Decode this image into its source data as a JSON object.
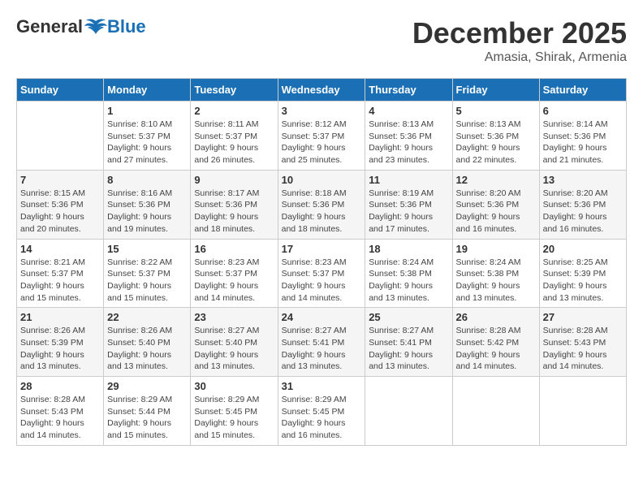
{
  "logo": {
    "general": "General",
    "blue": "Blue"
  },
  "title": {
    "month": "December 2025",
    "location": "Amasia, Shirak, Armenia"
  },
  "days_of_week": [
    "Sunday",
    "Monday",
    "Tuesday",
    "Wednesday",
    "Thursday",
    "Friday",
    "Saturday"
  ],
  "weeks": [
    [
      {
        "day": "",
        "info": ""
      },
      {
        "day": "1",
        "info": "Sunrise: 8:10 AM\nSunset: 5:37 PM\nDaylight: 9 hours\nand 27 minutes."
      },
      {
        "day": "2",
        "info": "Sunrise: 8:11 AM\nSunset: 5:37 PM\nDaylight: 9 hours\nand 26 minutes."
      },
      {
        "day": "3",
        "info": "Sunrise: 8:12 AM\nSunset: 5:37 PM\nDaylight: 9 hours\nand 25 minutes."
      },
      {
        "day": "4",
        "info": "Sunrise: 8:13 AM\nSunset: 5:36 PM\nDaylight: 9 hours\nand 23 minutes."
      },
      {
        "day": "5",
        "info": "Sunrise: 8:13 AM\nSunset: 5:36 PM\nDaylight: 9 hours\nand 22 minutes."
      },
      {
        "day": "6",
        "info": "Sunrise: 8:14 AM\nSunset: 5:36 PM\nDaylight: 9 hours\nand 21 minutes."
      }
    ],
    [
      {
        "day": "7",
        "info": "Sunrise: 8:15 AM\nSunset: 5:36 PM\nDaylight: 9 hours\nand 20 minutes."
      },
      {
        "day": "8",
        "info": "Sunrise: 8:16 AM\nSunset: 5:36 PM\nDaylight: 9 hours\nand 19 minutes."
      },
      {
        "day": "9",
        "info": "Sunrise: 8:17 AM\nSunset: 5:36 PM\nDaylight: 9 hours\nand 18 minutes."
      },
      {
        "day": "10",
        "info": "Sunrise: 8:18 AM\nSunset: 5:36 PM\nDaylight: 9 hours\nand 18 minutes."
      },
      {
        "day": "11",
        "info": "Sunrise: 8:19 AM\nSunset: 5:36 PM\nDaylight: 9 hours\nand 17 minutes."
      },
      {
        "day": "12",
        "info": "Sunrise: 8:20 AM\nSunset: 5:36 PM\nDaylight: 9 hours\nand 16 minutes."
      },
      {
        "day": "13",
        "info": "Sunrise: 8:20 AM\nSunset: 5:36 PM\nDaylight: 9 hours\nand 16 minutes."
      }
    ],
    [
      {
        "day": "14",
        "info": "Sunrise: 8:21 AM\nSunset: 5:37 PM\nDaylight: 9 hours\nand 15 minutes."
      },
      {
        "day": "15",
        "info": "Sunrise: 8:22 AM\nSunset: 5:37 PM\nDaylight: 9 hours\nand 15 minutes."
      },
      {
        "day": "16",
        "info": "Sunrise: 8:23 AM\nSunset: 5:37 PM\nDaylight: 9 hours\nand 14 minutes."
      },
      {
        "day": "17",
        "info": "Sunrise: 8:23 AM\nSunset: 5:37 PM\nDaylight: 9 hours\nand 14 minutes."
      },
      {
        "day": "18",
        "info": "Sunrise: 8:24 AM\nSunset: 5:38 PM\nDaylight: 9 hours\nand 13 minutes."
      },
      {
        "day": "19",
        "info": "Sunrise: 8:24 AM\nSunset: 5:38 PM\nDaylight: 9 hours\nand 13 minutes."
      },
      {
        "day": "20",
        "info": "Sunrise: 8:25 AM\nSunset: 5:39 PM\nDaylight: 9 hours\nand 13 minutes."
      }
    ],
    [
      {
        "day": "21",
        "info": "Sunrise: 8:26 AM\nSunset: 5:39 PM\nDaylight: 9 hours\nand 13 minutes."
      },
      {
        "day": "22",
        "info": "Sunrise: 8:26 AM\nSunset: 5:40 PM\nDaylight: 9 hours\nand 13 minutes."
      },
      {
        "day": "23",
        "info": "Sunrise: 8:27 AM\nSunset: 5:40 PM\nDaylight: 9 hours\nand 13 minutes."
      },
      {
        "day": "24",
        "info": "Sunrise: 8:27 AM\nSunset: 5:41 PM\nDaylight: 9 hours\nand 13 minutes."
      },
      {
        "day": "25",
        "info": "Sunrise: 8:27 AM\nSunset: 5:41 PM\nDaylight: 9 hours\nand 13 minutes."
      },
      {
        "day": "26",
        "info": "Sunrise: 8:28 AM\nSunset: 5:42 PM\nDaylight: 9 hours\nand 14 minutes."
      },
      {
        "day": "27",
        "info": "Sunrise: 8:28 AM\nSunset: 5:43 PM\nDaylight: 9 hours\nand 14 minutes."
      }
    ],
    [
      {
        "day": "28",
        "info": "Sunrise: 8:28 AM\nSunset: 5:43 PM\nDaylight: 9 hours\nand 14 minutes."
      },
      {
        "day": "29",
        "info": "Sunrise: 8:29 AM\nSunset: 5:44 PM\nDaylight: 9 hours\nand 15 minutes."
      },
      {
        "day": "30",
        "info": "Sunrise: 8:29 AM\nSunset: 5:45 PM\nDaylight: 9 hours\nand 15 minutes."
      },
      {
        "day": "31",
        "info": "Sunrise: 8:29 AM\nSunset: 5:45 PM\nDaylight: 9 hours\nand 16 minutes."
      },
      {
        "day": "",
        "info": ""
      },
      {
        "day": "",
        "info": ""
      },
      {
        "day": "",
        "info": ""
      }
    ]
  ]
}
